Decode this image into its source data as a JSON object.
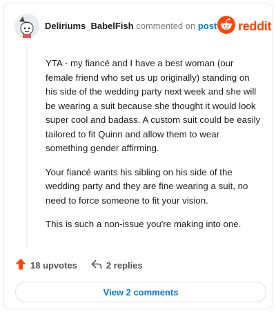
{
  "comment": {
    "username": "Deliriums_BabelFish",
    "action_text": "commented on",
    "post_link": "post",
    "body": [
      "YTA - my fiancé and I have a best woman (our female friend who set us up originally) standing on his side of the wedding party next week and she will be wearing a suit because she thought it would look super cool and badass. A custom suit could be easily tailored to fit Quinn and allow them to wear something gender affirming.",
      "Your fiancé wants his sibling on his side of the wedding party and they are fine wearing a suit, no need to force someone to fit your vision.",
      "This is such a non-issue you're making into one."
    ],
    "upvotes": "18 upvotes",
    "replies": "2 replies",
    "view_comments": "View 2 comments"
  },
  "brand": {
    "name": "reddit",
    "accent": "#ff4500",
    "link": "#0079d3"
  },
  "icons": {
    "upvote": "upvote-arrow-icon",
    "reply": "reply-arrow-icon",
    "logo": "reddit-alien-icon"
  }
}
